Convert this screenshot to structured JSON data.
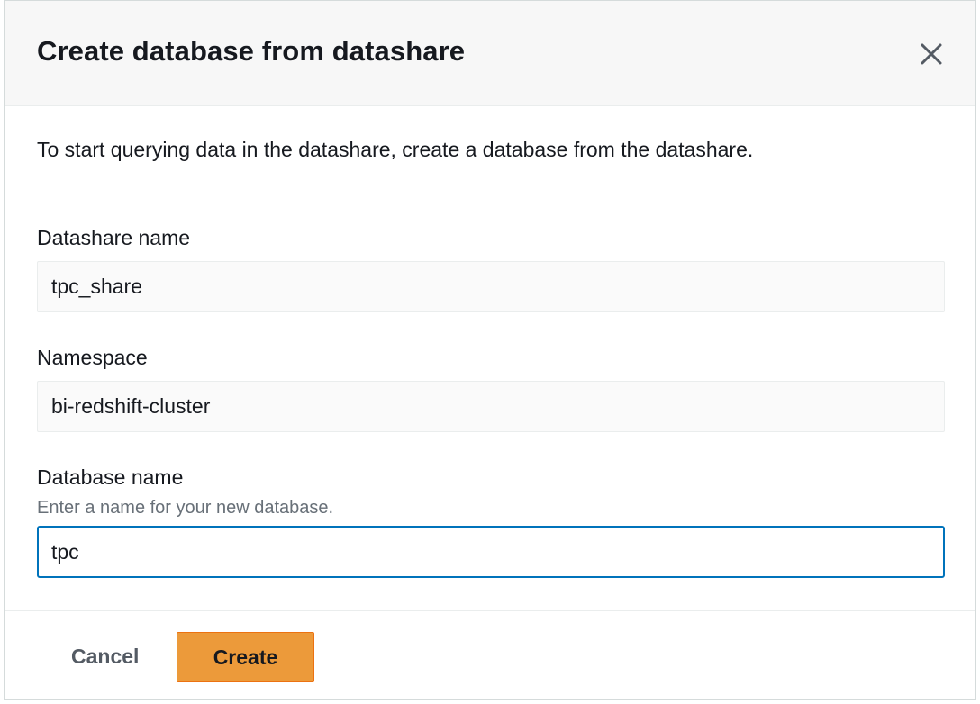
{
  "modal": {
    "title": "Create database from datashare",
    "close_icon": "close-icon",
    "intro": "To start querying data in the datashare, create a database from the datashare.",
    "fields": {
      "datashare_name": {
        "label": "Datashare name",
        "value": "tpc_share"
      },
      "namespace": {
        "label": "Namespace",
        "value": "bi-redshift-cluster"
      },
      "database_name": {
        "label": "Database name",
        "description": "Enter a name for your new database.",
        "value": "tpc"
      }
    },
    "footer": {
      "cancel_label": "Cancel",
      "create_label": "Create"
    }
  },
  "colors": {
    "primary_button": "#ec9a3a",
    "input_focus_border": "#0073bb",
    "header_background": "#f7f7f7",
    "text": "#16191f",
    "secondary_text": "#687078"
  }
}
